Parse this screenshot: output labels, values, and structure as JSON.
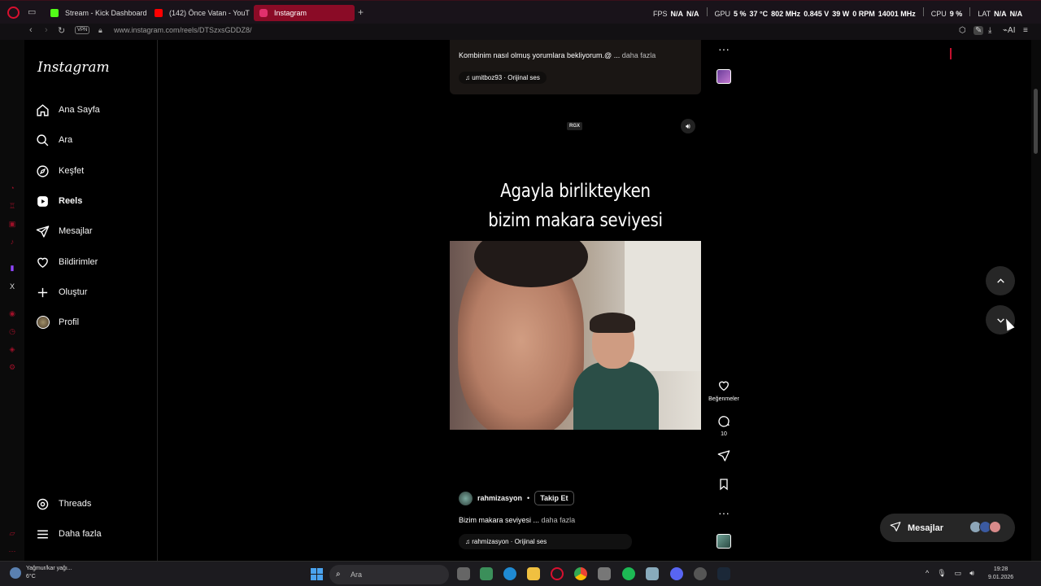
{
  "browser": {
    "tabs": [
      {
        "label": "Stream - Kick Dashboard",
        "fav_color": "#53fc18"
      },
      {
        "label": "(142) Önce Vatan - YouTu",
        "fav_color": "#ff0000"
      },
      {
        "label": "Instagram",
        "fav_color": "#e1306c"
      }
    ],
    "url": "www.instagram.com/reels/DTSzxsGDDZ8/",
    "vpn_label": "VPN",
    "ai_label": "AI",
    "accent": "#c4102e"
  },
  "stats": {
    "fps_label": "FPS",
    "fps_v1": "N/A",
    "fps_v2": "N/A",
    "gpu_label": "GPU",
    "gpu_load": "5 %",
    "gpu_temp": "37 °C",
    "gpu_clock": "802 MHz",
    "gpu_volt": "0.845 V",
    "gpu_power": "39 W",
    "gpu_fan": "0 RPM",
    "gpu_mem": "14001 MHz",
    "cpu_label": "CPU",
    "cpu_load": "9 %",
    "lat_label": "LAT",
    "lat_v1": "N/A",
    "lat_v2": "N/A"
  },
  "sidebar": {
    "logo": "Instagram",
    "items": [
      {
        "label": "Ana Sayfa",
        "icon": "home-icon"
      },
      {
        "label": "Ara",
        "icon": "search-icon"
      },
      {
        "label": "Keşfet",
        "icon": "compass-icon"
      },
      {
        "label": "Reels",
        "icon": "reels-icon"
      },
      {
        "label": "Mesajlar",
        "icon": "send-icon"
      },
      {
        "label": "Bildirimler",
        "icon": "heart-icon"
      },
      {
        "label": "Oluştur",
        "icon": "plus-icon"
      },
      {
        "label": "Profil",
        "icon": "avatar"
      }
    ],
    "threads": "Threads",
    "more": "Daha fazla"
  },
  "prev_reel": {
    "caption": "Kombinim nasıl olmuş yorumlara bekliyorum.@ ...",
    "more": "daha fazla",
    "audio": "umitboz93 · Orijinal ses"
  },
  "reel": {
    "watermark": "RGX",
    "title_line1": "Agayla birlikteyken",
    "title_line2": "bizim makara seviyesi",
    "author": "rahmizasyon",
    "dot": "•",
    "follow": "Takip Et",
    "caption": "Bizim makara seviyesi ...",
    "more": "daha fazla",
    "audio": "rahmizasyon · Orijinal ses"
  },
  "actions": {
    "likes_label": "Beğenmeler",
    "comments_count": "10"
  },
  "messages_pill": {
    "label": "Mesajlar"
  },
  "taskbar": {
    "weather_line1": "Yağmur/kar yağı...",
    "weather_line2": "6°C",
    "search": "Ara",
    "time": "19:28",
    "date": "9.01.2026"
  }
}
